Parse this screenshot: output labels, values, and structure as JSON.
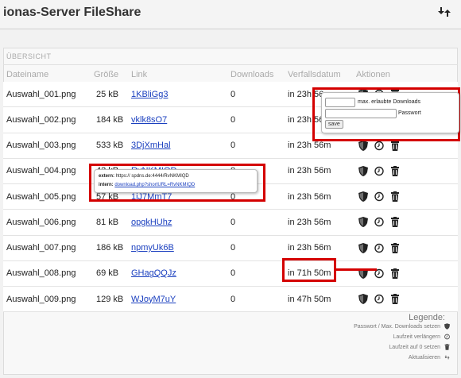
{
  "app": {
    "title": "ionas-Server FileShare"
  },
  "section": {
    "label": "ÜBERSICHT"
  },
  "headers": {
    "name": "Dateiname",
    "size": "Größe",
    "link": "Link",
    "downloads": "Downloads",
    "expiry": "Verfallsdatum",
    "actions": "Aktionen"
  },
  "files": [
    {
      "name": "Auswahl_001.png",
      "size": "25 kB",
      "link": "1KBliGg3",
      "downloads": "0",
      "expiry": "in 23h 56m"
    },
    {
      "name": "Auswahl_002.png",
      "size": "184 kB",
      "link": "vklk8sO7",
      "downloads": "0",
      "expiry": "in 23h 56m"
    },
    {
      "name": "Auswahl_003.png",
      "size": "533 kB",
      "link": "3DjXmHal",
      "downloads": "0",
      "expiry": "in 23h 56m"
    },
    {
      "name": "Auswahl_004.png",
      "size": "42 kB",
      "link": "RvNKMIQD",
      "downloads": "0",
      "expiry": "in 23h 56m"
    },
    {
      "name": "Auswahl_005.png",
      "size": "57 kB",
      "link": "1iJ7MmT7",
      "downloads": "0",
      "expiry": "in 23h 56m"
    },
    {
      "name": "Auswahl_006.png",
      "size": "81 kB",
      "link": "opgkHUhz",
      "downloads": "0",
      "expiry": "in 23h 56m"
    },
    {
      "name": "Auswahl_007.png",
      "size": "186 kB",
      "link": "npmyUk6B",
      "downloads": "0",
      "expiry": "in 23h 56m"
    },
    {
      "name": "Auswahl_008.png",
      "size": "69 kB",
      "link": "GHagQQJz",
      "downloads": "0",
      "expiry": "in 71h 50m"
    },
    {
      "name": "Auswahl_009.png",
      "size": "129 kB",
      "link": "WJoyM7uY",
      "downloads": "0",
      "expiry": "in 47h 50m"
    }
  ],
  "password_popup": {
    "max_downloads_label": "max. erlaubte Downloads",
    "password_label": "Passwort",
    "save_label": "save"
  },
  "link_popup": {
    "extern_label": "extern:",
    "extern_url": "https://          spdns.de:4444/RvNKMIQD",
    "intern_label": "intern:",
    "intern_url": "download.php?shortURL=RvNKMIQD"
  },
  "legend": {
    "title": "Legende:",
    "items": [
      "Passwort / Max. Downloads setzen",
      "Laufzeit verlängern",
      "Laufzeit auf 0 setzen",
      "Aktualisieren"
    ]
  },
  "colors": {
    "highlight": "#d40000",
    "link": "#1a3fbf"
  },
  "icons": {
    "refresh": "refresh-icon",
    "shield": "shield-icon",
    "clock": "clock-icon",
    "trash": "trash-icon"
  }
}
